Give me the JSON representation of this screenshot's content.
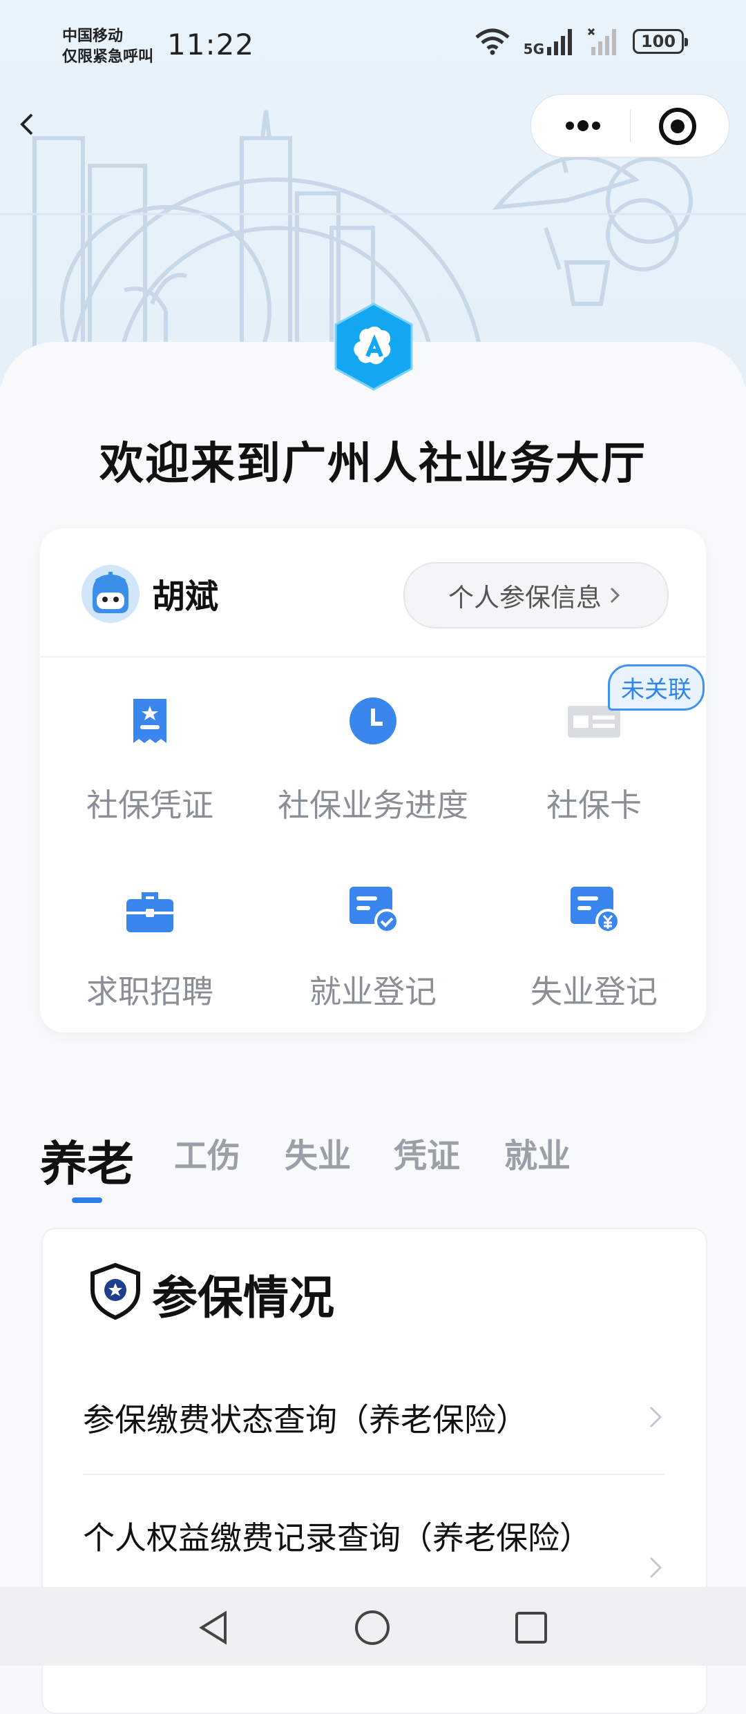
{
  "status_bar": {
    "carrier_line1": "中国移动",
    "carrier_line2": "仅限紧急呼叫",
    "time": "11:22",
    "network": "5G",
    "battery": "100"
  },
  "header": {
    "welcome": "欢迎来到广州人社业务大厅"
  },
  "user_card": {
    "name": "胡斌",
    "info_button": "个人参保信息",
    "badge": "未关联",
    "tiles": [
      {
        "label": "社保凭证",
        "icon": "certificate-icon"
      },
      {
        "label": "社保业务进度",
        "icon": "clock-icon"
      },
      {
        "label": "社保卡",
        "icon": "card-icon"
      },
      {
        "label": "求职招聘",
        "icon": "briefcase-icon"
      },
      {
        "label": "就业登记",
        "icon": "registration-check-icon"
      },
      {
        "label": "失业登记",
        "icon": "registration-yuan-icon"
      }
    ]
  },
  "tabs": [
    "养老",
    "工伤",
    "失业",
    "凭证",
    "就业"
  ],
  "active_tab": "养老",
  "section": {
    "title": "参保情况",
    "rows": [
      "参保缴费状态查询（养老保险）",
      "个人权益缴费记录查询（养老保险）"
    ]
  },
  "colors": {
    "accent": "#2b7de9",
    "icon_blue": "#3b86ec",
    "logo_blue": "#12a7f0",
    "muted_text": "#8a8f96"
  }
}
